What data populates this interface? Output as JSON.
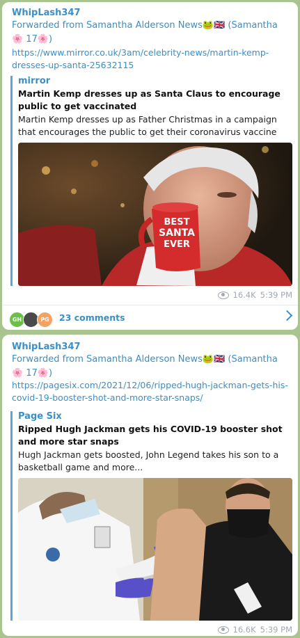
{
  "messages": [
    {
      "author": "WhipLash347",
      "forwarded": "Forwarded from Samantha Alderson News🐸🇬🇧 (Samantha 🌸 17🌸)",
      "url": "https://www.mirror.co.uk/3am/celebrity-news/martin-kemp-dresses-up-santa-25632115",
      "preview": {
        "site": "mirror",
        "title": "Martin Kemp dresses up as Santa Claus to encourage public to get vaccinated",
        "description": "Martin Kemp dresses up as Father Christmas in a campaign that encourages the public to get their coronavirus vaccine",
        "mug_text": [
          "BEST",
          "SANTA",
          "EVER"
        ]
      },
      "views": "16.4K",
      "time": "5:39 PM",
      "comments": {
        "label": "23 comments",
        "avatars": [
          {
            "initials": "GH",
            "color": "#6cc04a"
          },
          {
            "initials": "",
            "color": "#4a4a4a"
          },
          {
            "initials": "PG",
            "color": "#f4a261"
          }
        ]
      }
    },
    {
      "author": "WhipLash347",
      "forwarded": "Forwarded from Samantha Alderson News🐸🇬🇧 (Samantha 🌸 17🌸)",
      "url": "https://pagesix.com/2021/12/06/ripped-hugh-jackman-gets-his-covid-19-booster-shot-and-more-star-snaps/",
      "preview": {
        "site": "Page Six",
        "title": "Ripped Hugh Jackman gets his COVID-19 booster shot and more star snaps",
        "description": "Hugh Jackman gets boosted, John Legend takes his son to a basketball game and more..."
      },
      "views": "16.6K",
      "time": "5:39 PM"
    }
  ]
}
